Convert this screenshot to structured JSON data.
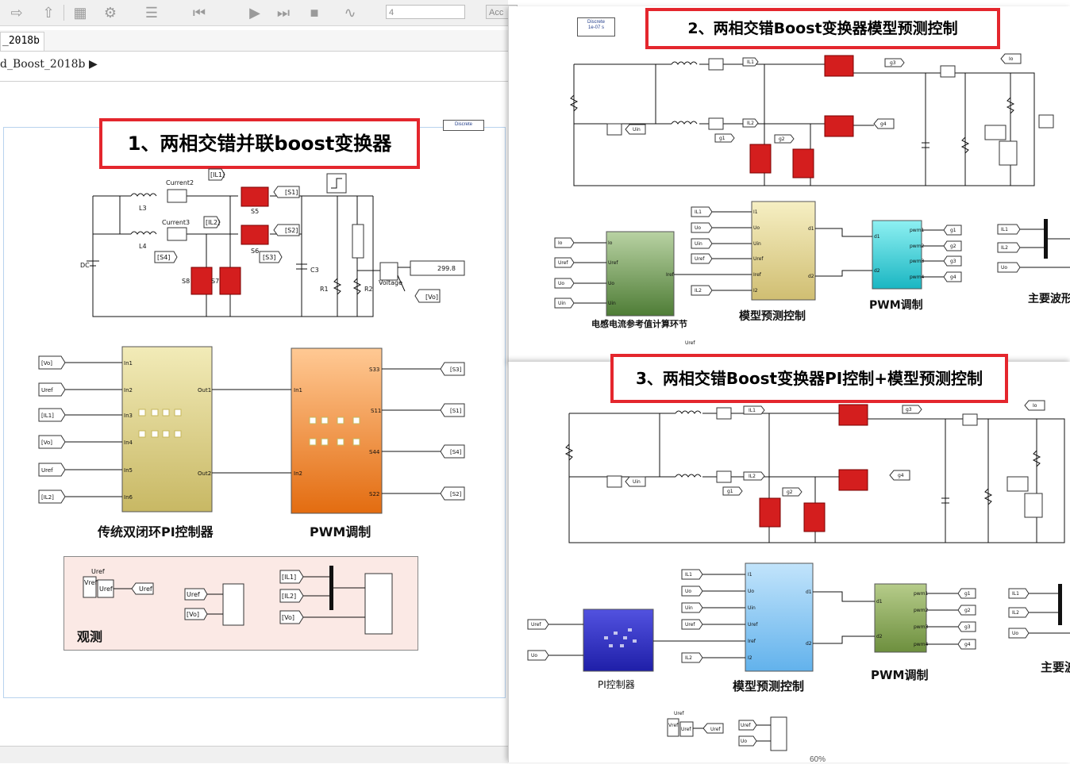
{
  "toolbar": {
    "sim_time": "4",
    "accel": "Acc",
    "icons": [
      "arrow-forward-icon",
      "arrow-up-icon",
      "library-icon",
      "gear-icon",
      "model-explorer-icon",
      "step-back-icon",
      "run-icon",
      "step-forward-icon",
      "stop-icon",
      "scope-icon"
    ]
  },
  "tab": {
    "label": "_2018b"
  },
  "breadcrumb": {
    "path": "d_Boost_2018b"
  },
  "status": {
    "zoom": "60%"
  },
  "panel1": {
    "title": "1、两相交错并联boost变换器",
    "discrete_label": "Discrete",
    "circuit": {
      "source": "DC",
      "inductor_a": "L3",
      "inductor_b": "L4",
      "current_a": "Current2",
      "current_b": "Current3",
      "tag_il1": "[IL1]",
      "tag_il2": "[IL2]",
      "switch_s5": "S5",
      "switch_s6": "S6",
      "switch_s7": "S7",
      "switch_s8": "S8",
      "goto_s1": "[S1]",
      "goto_s2": "[S2]",
      "goto_s3": "[S3]",
      "goto_s4": "[S4]",
      "cap": "C3",
      "r1": "R1",
      "r2": "R2",
      "voltage": "Voltage",
      "display": "299.8",
      "tag_vo": "[Vo]"
    },
    "pi_block": {
      "caption": "传统双闭环PI控制器",
      "inputs": [
        "[Vo]",
        "Uref",
        "[IL1]",
        "[Vo]",
        "Uref",
        "[IL2]"
      ],
      "in_ports": [
        "In1",
        "In2",
        "In3",
        "In4",
        "In5",
        "In6"
      ],
      "out_ports": [
        "Out1",
        "Out2"
      ]
    },
    "pwm_block": {
      "caption": "PWM调制",
      "in_ports": [
        "In1",
        "In2"
      ],
      "out_ports": [
        "S33",
        "S11",
        "S44",
        "S22"
      ],
      "outputs": [
        "[S3]",
        "[S1]",
        "[S4]",
        "[S2]"
      ]
    },
    "observe": {
      "caption": "观测",
      "uref_top": "Uref",
      "uref_block": "Uref",
      "vref": "Vref",
      "uref_goto": "Uref",
      "scope_in": [
        "Uref",
        "[Vo]"
      ],
      "mux_in": [
        "[IL1]",
        "[IL2]",
        "[Vo]"
      ]
    }
  },
  "panel2": {
    "title": "2、两相交错Boost变换器模型预测控制",
    "discrete_label": "Discrete\n1e-07 s",
    "circuit_tags": {
      "il1": "IL1",
      "il2": "IL2",
      "g1": "g1",
      "g2": "g2",
      "g3": "g3",
      "g4": "g4",
      "io": "Io",
      "uin": "Uin"
    },
    "ref_block": {
      "caption": "电感电流参考值计算环节",
      "inputs": [
        "Io",
        "Uref",
        "Uo",
        "Uin"
      ],
      "in_ports": [
        "Io",
        "Uref",
        "Uo",
        "Uin"
      ],
      "out_port": "Iref"
    },
    "mpc_block": {
      "caption": "模型预测控制",
      "inputs": [
        "IL1",
        "Uo",
        "Uin",
        "Uref",
        "IL2"
      ],
      "in_ports": [
        "I1",
        "Uo",
        "Uin",
        "Uref",
        "Iref",
        "I2"
      ],
      "out_ports": [
        "d1",
        "d2"
      ]
    },
    "pwm_block": {
      "caption": "PWM调制",
      "in_ports": [
        "d1",
        "d2"
      ],
      "out_ports": [
        "pwm1",
        "pwm2",
        "pwm3",
        "pwm4"
      ],
      "outputs": [
        "g1",
        "g2",
        "g3",
        "g4"
      ]
    },
    "wave": {
      "caption": "主要波形",
      "inputs": [
        "IL1",
        "IL2",
        "Uo"
      ]
    },
    "bottom_tag": "Uref"
  },
  "panel3": {
    "title": "3、两相交错Boost变换器PI控制+模型预测控制",
    "circuit_tags": {
      "il1": "IL1",
      "il2": "IL2",
      "g1": "g1",
      "g2": "g2",
      "g3": "g3",
      "g4": "g4",
      "io": "Io",
      "uin": "Uin"
    },
    "pi_block": {
      "caption": "PI控制器",
      "inputs": [
        "Uref",
        "Uo"
      ],
      "in_ports": [
        "Uref",
        "Uo"
      ],
      "out_port": "Iref"
    },
    "mpc_block": {
      "caption": "模型预测控制",
      "inputs": [
        "IL1",
        "Uo",
        "Uin",
        "Uref",
        "IL2"
      ],
      "in_ports": [
        "I1",
        "Uo",
        "Uin",
        "Uref",
        "Iref",
        "I2"
      ],
      "out_ports": [
        "d1",
        "d2"
      ]
    },
    "pwm_block": {
      "caption": "PWM调制",
      "in_ports": [
        "d1",
        "d2"
      ],
      "out_ports": [
        "pwm1",
        "pwm2",
        "pwm3",
        "pwm4"
      ],
      "outputs": [
        "g1",
        "g2",
        "g3",
        "g4"
      ]
    },
    "wave": {
      "caption": "主要波",
      "inputs": [
        "IL1",
        "IL2",
        "Uo"
      ]
    },
    "observe": {
      "uref_top": "Uref",
      "vref": "Vref",
      "uref_block": "Uref",
      "uref_goto": "Uref",
      "scope_in": [
        "Uref",
        "Uo"
      ]
    }
  },
  "colors": {
    "title_border": "#e4262d",
    "mosfet": "#d41e1e",
    "pi_block": "#e8de9c",
    "pwm_orange": "#f28a2c",
    "mpc_yellow": "#efe4a6",
    "ref_green": "#7ea163",
    "pwm_cyan": "#39c9d2",
    "pi_blue": "#2e2ec2",
    "mpc_blue": "#8fc9f0",
    "pwm_green": "#8ea858",
    "observe_bg": "#fbe9e5"
  }
}
